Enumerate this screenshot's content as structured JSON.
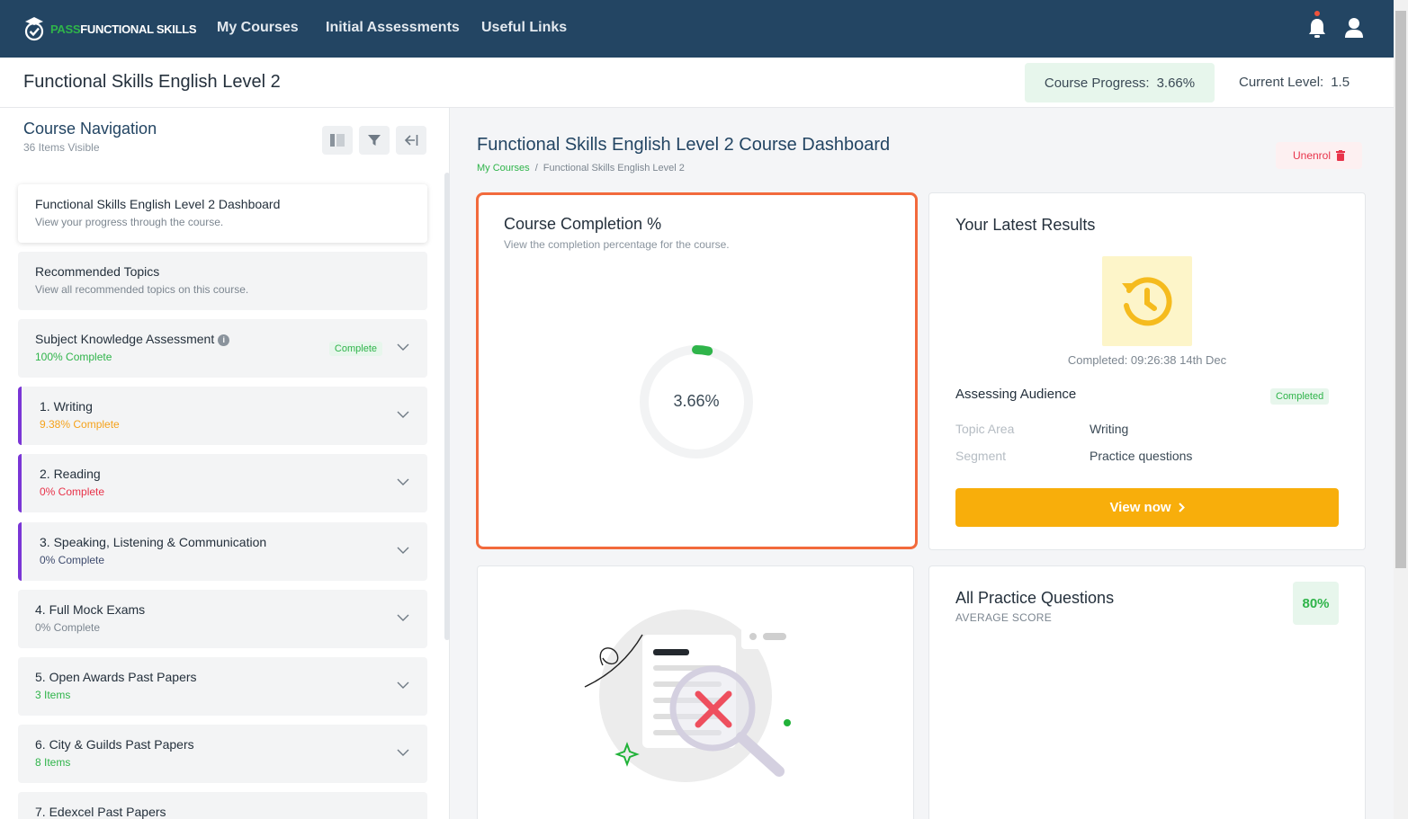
{
  "nav": {
    "logo_green": "PASS",
    "logo_white": "FUNCTIONAL SKILLS",
    "links": [
      "My Courses",
      "Initial Assessments",
      "Useful Links"
    ],
    "icons": [
      "bell-icon",
      "user-icon"
    ]
  },
  "header": {
    "course_title": "Functional Skills English Level 2",
    "progress_label": "Course Progress:",
    "progress_value": "3.66%",
    "level_label": "Current Level:",
    "level_value": "1.5"
  },
  "sidebar": {
    "title": "Course Navigation",
    "subtitle": "36 Items Visible",
    "tools": [
      "layout-icon",
      "filter-icon",
      "collapse-left-icon"
    ],
    "items": [
      {
        "title": "Functional Skills English Level 2 Dashboard",
        "sub": "View your progress through the course."
      },
      {
        "title": "Recommended Topics",
        "sub": "View all recommended topics on this course."
      },
      {
        "title": "Subject Knowledge Assessment",
        "sub": "100% Complete",
        "tag": "Complete"
      },
      {
        "title": "1. Writing",
        "sub": "9.38% Complete"
      },
      {
        "title": "2. Reading",
        "sub": "0% Complete"
      },
      {
        "title": "3. Speaking, Listening & Communication",
        "sub": "0% Complete"
      },
      {
        "title": "4. Full Mock Exams",
        "sub": "0% Complete"
      },
      {
        "title": "5. Open Awards Past Papers",
        "sub": "3 Items"
      },
      {
        "title": "6. City & Guilds Past Papers",
        "sub": "8 Items"
      },
      {
        "title": "7. Edexcel Past Papers",
        "sub": ""
      }
    ]
  },
  "main": {
    "title": "Functional Skills English Level 2 Course Dashboard",
    "breadcrumb": [
      "My Courses",
      "Functional Skills English Level 2"
    ],
    "unenrol": "Unenrol",
    "completion": {
      "title": "Course Completion %",
      "subtitle": "View the completion percentage for the course.",
      "percent_label": "3.66%",
      "percent": 3.66
    },
    "results": {
      "title": "Your Latest Results",
      "completed": "Completed: 09:26:38 14th Dec",
      "name": "Assessing Audience",
      "badge": "Completed",
      "topic_key": "Topic Area",
      "topic_val": "Writing",
      "segment_key": "Segment",
      "segment_val": "Practice questions",
      "button": "View now"
    },
    "practice": {
      "title": "All Practice Questions",
      "subtitle": "AVERAGE SCORE",
      "score": "80%"
    }
  },
  "colors": {
    "nav_bg": "#234563",
    "accent_green": "#2fb44a",
    "highlight_border": "#f26a3c",
    "button_yellow": "#f8ae0b",
    "bar_purple": "#7a36d6"
  }
}
